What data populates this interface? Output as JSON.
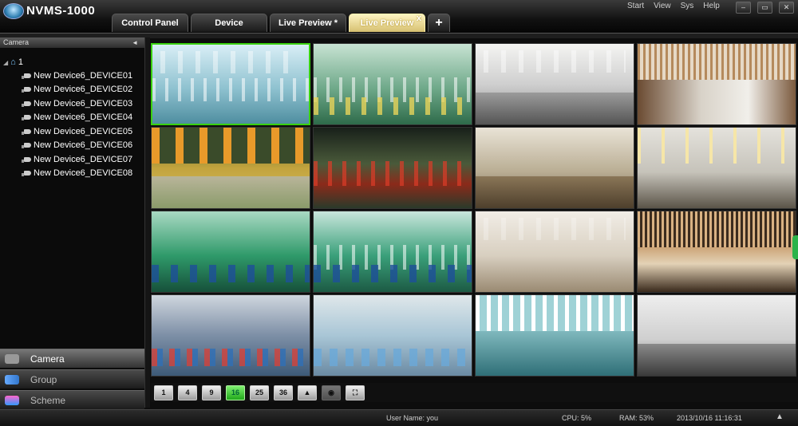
{
  "app": {
    "title": "NVMS-1000"
  },
  "menu": [
    "Start",
    "View",
    "Sys",
    "Help"
  ],
  "window_buttons": [
    "–",
    "▭",
    "✕"
  ],
  "tabs": [
    {
      "label": "Control Panel"
    },
    {
      "label": "Device"
    },
    {
      "label": "Live Preview *"
    },
    {
      "label": "Live Preview",
      "close": "x",
      "active": true
    }
  ],
  "add_tab": "+",
  "sidebar": {
    "header": "Camera",
    "collapse_arrow": "◄",
    "tree_root": "1",
    "devices": [
      "New Device6_DEVICE01",
      "New Device6_DEVICE02",
      "New Device6_DEVICE03",
      "New Device6_DEVICE04",
      "New Device6_DEVICE05",
      "New Device6_DEVICE06",
      "New Device6_DEVICE07",
      "New Device6_DEVICE08"
    ],
    "nav": [
      "Camera",
      "Group",
      "Scheme"
    ]
  },
  "layout_buttons": [
    "1",
    "4",
    "9",
    "16",
    "25",
    "36"
  ],
  "active_layout": "16",
  "colors": {
    "accent": "#39d10f",
    "active_tab": "#f4e7a8",
    "background": "#0d0d0d"
  },
  "status": {
    "user": "User Name: you",
    "cpu": "CPU: 5%",
    "ram": "RAM: 53%",
    "datetime": "2013/10/16 11:16:31"
  }
}
